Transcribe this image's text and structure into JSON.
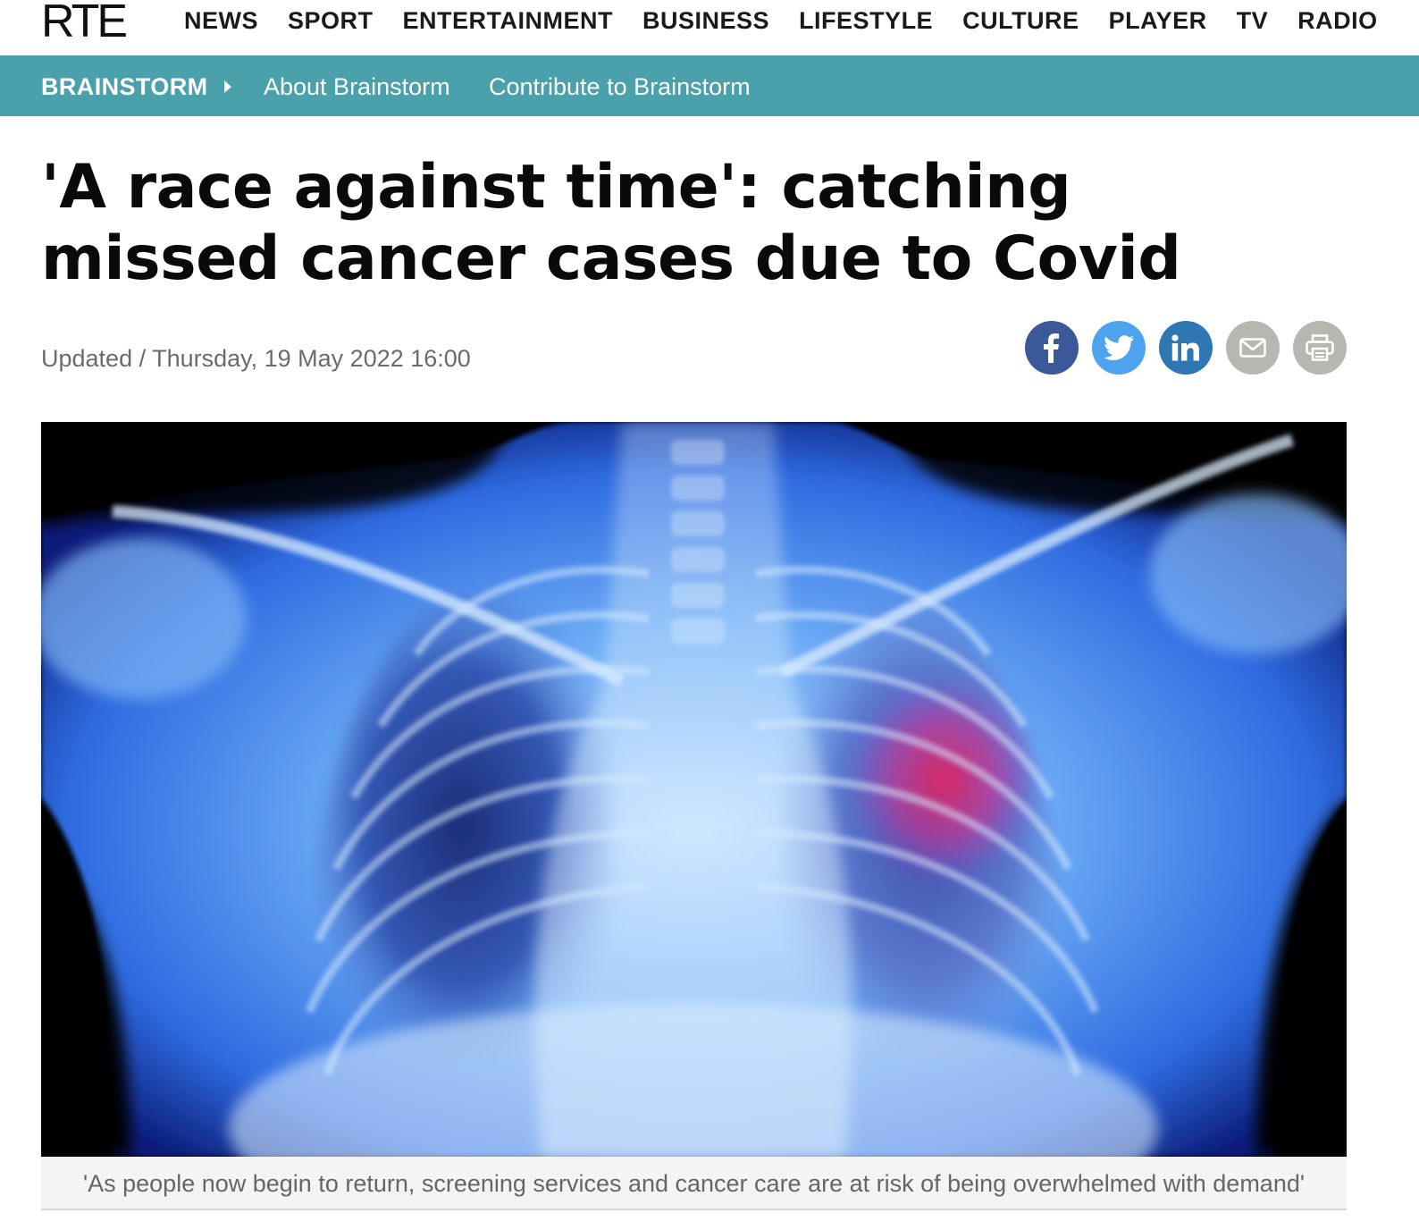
{
  "site": {
    "logo": "RTE",
    "nav": [
      "NEWS",
      "SPORT",
      "ENTERTAINMENT",
      "BUSINESS",
      "LIFESTYLE",
      "CULTURE",
      "PLAYER",
      "TV",
      "RADIO"
    ]
  },
  "section": {
    "name": "BRAINSTORM",
    "links": [
      "About Brainstorm",
      "Contribute to Brainstorm"
    ],
    "color": "#4aa0ab"
  },
  "article": {
    "headline": "'A race against time': catching missed cancer cases due to Covid",
    "dateline": "Updated / Thursday, 19 May 2022 16:00",
    "caption": "'As people now begin to return, screening services and cancer care are at risk of being overwhelmed with demand'"
  },
  "share": [
    {
      "name": "facebook",
      "icon": "facebook-icon",
      "color": "#3b5998"
    },
    {
      "name": "twitter",
      "icon": "twitter-icon",
      "color": "#4ea3ee"
    },
    {
      "name": "linkedin",
      "icon": "linkedin-icon",
      "color": "#2f77b2"
    },
    {
      "name": "email",
      "icon": "email-icon",
      "color": "#b8b6b0"
    },
    {
      "name": "print",
      "icon": "print-icon",
      "color": "#b8b6b0"
    }
  ]
}
